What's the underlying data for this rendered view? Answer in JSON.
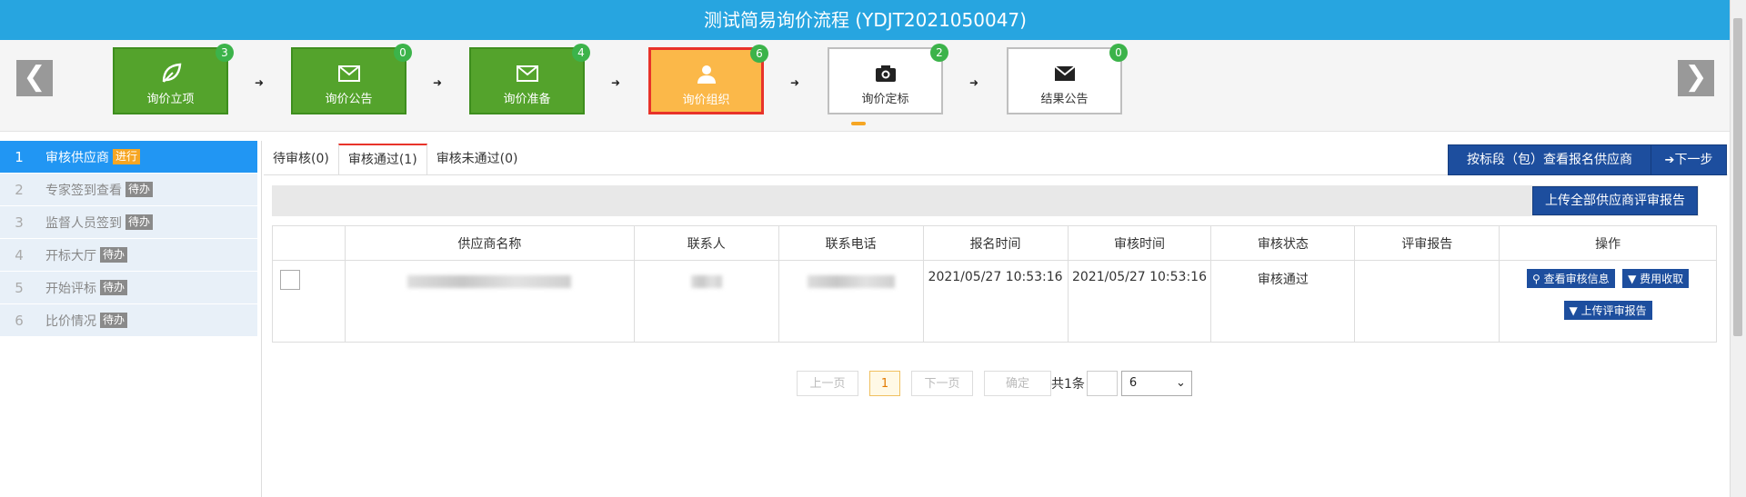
{
  "header": {
    "title": "测试简易询价流程 (YDJT2021050047)"
  },
  "stepbar": {
    "prev_glyph": "❮",
    "next_glyph": "❯",
    "arrow_glyph": "➜",
    "steps": [
      {
        "label": "询价立项",
        "badge": "3",
        "state": "done",
        "icon": "leaf-icon"
      },
      {
        "label": "询价公告",
        "badge": "0",
        "state": "done",
        "icon": "envelope-icon"
      },
      {
        "label": "询价准备",
        "badge": "4",
        "state": "done",
        "icon": "envelope-icon"
      },
      {
        "label": "询价组织",
        "badge": "6",
        "state": "current",
        "icon": "user-icon"
      },
      {
        "label": "询价定标",
        "badge": "2",
        "state": "todo",
        "icon": "camera-icon"
      },
      {
        "label": "结果公告",
        "badge": "0",
        "state": "todo",
        "icon": "envelope-icon"
      }
    ]
  },
  "sidebar": {
    "items": [
      {
        "num": "1",
        "label": "审核供应商",
        "tag": "进行"
      },
      {
        "num": "2",
        "label": "专家签到查看",
        "tag": "待办"
      },
      {
        "num": "3",
        "label": "监督人员签到",
        "tag": "待办"
      },
      {
        "num": "4",
        "label": "开标大厅",
        "tag": "待办"
      },
      {
        "num": "5",
        "label": "开始评标",
        "tag": "待办"
      },
      {
        "num": "6",
        "label": "比价情况",
        "tag": "待办"
      }
    ]
  },
  "tabs": [
    {
      "label": "待审核(0)"
    },
    {
      "label": "审核通过(1)"
    },
    {
      "label": "审核未通过(0)"
    }
  ],
  "buttons": {
    "view_by_section": "按标段（包）查看报名供应商",
    "next_step": "下一步",
    "upload_all": "上传全部供应商评审报告"
  },
  "table": {
    "headers": [
      "",
      "供应商名称",
      "联系人",
      "联系电话",
      "报名时间",
      "审核时间",
      "审核状态",
      "评审报告",
      "操作"
    ],
    "rows": [
      {
        "signup_time": "2021/05/27 10:53:16",
        "audit_time": "2021/05/27 10:53:16",
        "status": "审核通过",
        "report": "",
        "actions": {
          "view": "查看审核信息",
          "fee": "费用收取",
          "upload": "上传评审报告"
        }
      }
    ]
  },
  "pager": {
    "prev": "上一页",
    "current": "1",
    "next": "下一页",
    "confirm": "确定",
    "total": "共1条",
    "page_size": "6"
  },
  "colors": {
    "header": "#27a5e0",
    "done": "#54a32c",
    "current": "#fbb849",
    "accent": "#1d4e9e",
    "sidebar_active": "#2196f3"
  }
}
